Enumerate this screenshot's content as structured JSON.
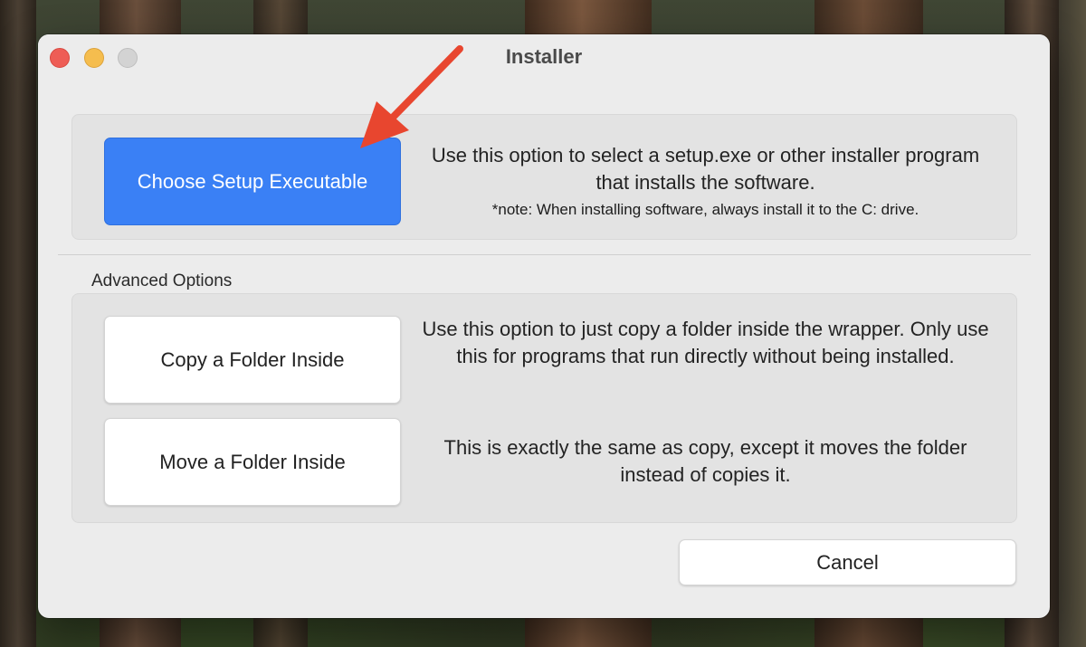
{
  "window": {
    "title": "Installer"
  },
  "primary": {
    "button_label": "Choose Setup Executable",
    "description": "Use this option to select a setup.exe or other installer program that installs the software.",
    "note": "*note: When installing software, always install it to the C: drive."
  },
  "advanced": {
    "section_label": "Advanced Options",
    "copy_button_label": "Copy a Folder Inside",
    "copy_description": "Use this option to just copy a folder inside the wrapper. Only use this for programs that run directly without being installed.",
    "move_button_label": "Move a Folder Inside",
    "move_description": "This is exactly the same as copy, except it moves the folder instead of copies it."
  },
  "footer": {
    "cancel_label": "Cancel"
  },
  "colors": {
    "accent_button": "#3a80f5",
    "annotation_arrow": "#e8462f",
    "close": "#ee5d56",
    "minimize": "#f5bd4e",
    "zoom_disabled": "#d3d3d3"
  },
  "icons": {
    "annotation": "arrow-icon"
  }
}
